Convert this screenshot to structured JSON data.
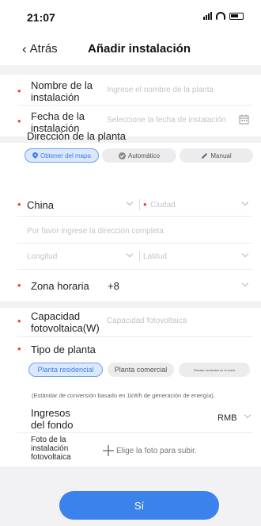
{
  "status": {
    "time": "21:07"
  },
  "nav": {
    "back_label": "Atrás",
    "title": "Añadir instalación"
  },
  "form": {
    "name": {
      "label_1": "Nombre de la",
      "label_2": "instalación",
      "placeholder": "Ingrese el nombre de la planta"
    },
    "date": {
      "label_1": "Fecha de la",
      "label_2": "instalación",
      "placeholder": "Seleccione la fecha de instalación"
    },
    "address": {
      "section_label": "Dirección de la planta",
      "options": [
        "Obtener del mapa",
        "Automático",
        "Manual"
      ],
      "country": "China",
      "city_placeholder": "Ciudad",
      "full_address_placeholder": "Por favor ingrese la dirección completa",
      "longitude_placeholder": "Longitud",
      "latitude_placeholder": "Latitud"
    },
    "timezone": {
      "label": "Zona horaria",
      "value": "+8"
    },
    "capacity": {
      "label_1": "Capacidad",
      "label_2": "fotovoltaica(W)",
      "placeholder": "Capacidad fotovoltaica"
    },
    "plant_type": {
      "label": "Tipo de planta",
      "options": [
        "Planta residencial",
        "Planta comercial",
        "Plantas montadas en el suelo"
      ],
      "note": "(Estándar de conversión basado en 1kWh de generación de energía)."
    },
    "income": {
      "label_1": "Ingresos",
      "label_2": "del fondo",
      "currency": "RMB"
    },
    "photo": {
      "label_1": "Foto de la",
      "label_2": "instalación",
      "label_3": "fotovoltaica",
      "hint": "Elige la foto para subir."
    }
  },
  "footer": {
    "confirm_label": "Sí"
  },
  "colors": {
    "accent": "#3b82ec",
    "required": "#e84040",
    "pill_active_bg": "#dbe8fb"
  }
}
